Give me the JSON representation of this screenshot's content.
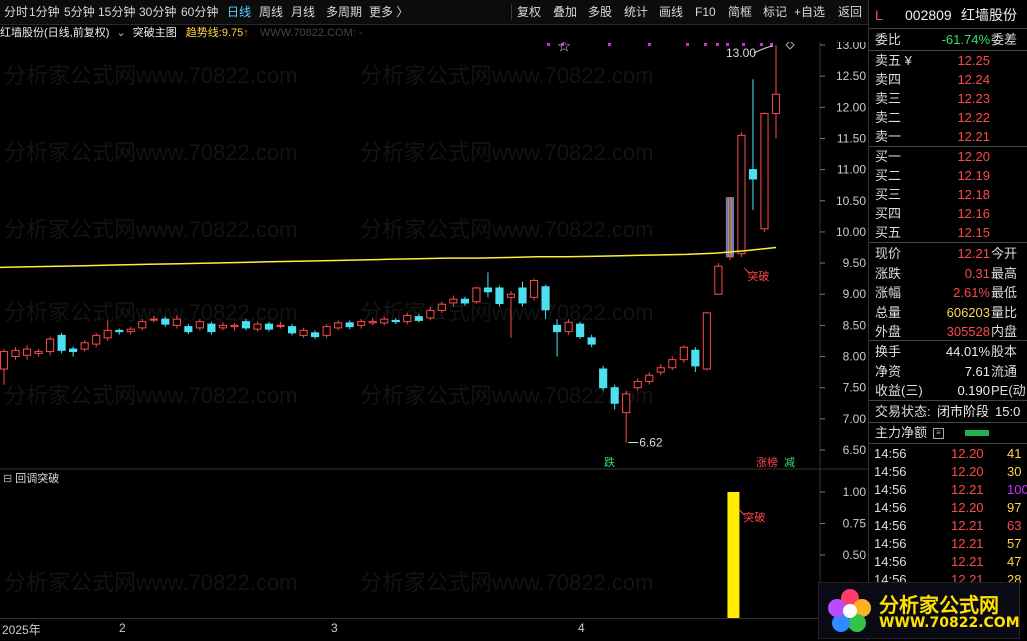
{
  "toolbar": {
    "periods": [
      "分时",
      "1分钟",
      "5分钟",
      "15分钟",
      "30分钟",
      "60分钟",
      "日线",
      "周线",
      "月线",
      "多周期",
      "更多 〉"
    ],
    "active_period": "日线",
    "tools": [
      "复权",
      "叠加",
      "多股",
      "统计",
      "画线",
      "F10",
      "简框",
      "标记",
      "+自选",
      "返回"
    ]
  },
  "chart_header": {
    "stock_name": "红墙股份",
    "mode": "(日线,前复权)",
    "indicator": "突破主图",
    "trend_label": "趋势线:",
    "trend_value": "9.75",
    "watermark_url": "WWW.70822.COM: -"
  },
  "watermark_text": "分析家公式网www.70822.com",
  "sub_chart": {
    "title": "回调突破"
  },
  "colors": {
    "up": "#ff4a4a",
    "down": "#4de1f0",
    "trend": "#ffee33",
    "signal": "#ffee00",
    "marker": "#cc33cc"
  },
  "annotations": {
    "high_label": "13.00",
    "low_label": "6.62",
    "breakout_label": "突破",
    "sub_breakout_label": "突破",
    "fall_tag": "跌",
    "limit_tag_1": "涨榜",
    "limit_tag_2": "减"
  },
  "date_axis": [
    "2025年",
    "2",
    "3",
    "4"
  ],
  "chart_data": {
    "type": "candlestick",
    "price_axis": {
      "ticks": [
        "13.00",
        "12.50",
        "12.00",
        "11.50",
        "11.00",
        "10.50",
        "10.00",
        "9.50",
        "9.00",
        "8.50",
        "8.00",
        "7.50",
        "7.00",
        "6.50"
      ],
      "range": [
        6.35,
        13.3
      ]
    },
    "candles": [
      [
        7.8,
        8.08,
        7.55,
        8.12
      ],
      [
        8.0,
        8.1,
        7.95,
        8.15
      ],
      [
        8.02,
        8.12,
        7.95,
        8.18
      ],
      [
        8.05,
        8.08,
        8.0,
        8.12
      ],
      [
        8.08,
        8.28,
        8.02,
        8.32
      ],
      [
        8.34,
        8.1,
        8.05,
        8.38
      ],
      [
        8.12,
        8.08,
        8.0,
        8.16
      ],
      [
        8.12,
        8.22,
        8.08,
        8.26
      ],
      [
        8.2,
        8.34,
        8.15,
        8.38
      ],
      [
        8.3,
        8.42,
        8.25,
        8.58
      ],
      [
        8.42,
        8.4,
        8.35,
        8.45
      ],
      [
        8.4,
        8.44,
        8.35,
        8.48
      ],
      [
        8.46,
        8.56,
        8.42,
        8.6
      ],
      [
        8.6,
        8.6,
        8.55,
        8.65
      ],
      [
        8.6,
        8.52,
        8.48,
        8.64
      ],
      [
        8.5,
        8.6,
        8.45,
        8.66
      ],
      [
        8.48,
        8.4,
        8.36,
        8.52
      ],
      [
        8.46,
        8.56,
        8.42,
        8.6
      ],
      [
        8.52,
        8.4,
        8.35,
        8.56
      ],
      [
        8.46,
        8.5,
        8.42,
        8.55
      ],
      [
        8.48,
        8.5,
        8.42,
        8.54
      ],
      [
        8.56,
        8.46,
        8.42,
        8.6
      ],
      [
        8.44,
        8.52,
        8.4,
        8.56
      ],
      [
        8.52,
        8.44,
        8.4,
        8.56
      ],
      [
        8.5,
        8.5,
        8.45,
        8.56
      ],
      [
        8.48,
        8.38,
        8.34,
        8.52
      ],
      [
        8.34,
        8.42,
        8.3,
        8.46
      ],
      [
        8.38,
        8.32,
        8.28,
        8.42
      ],
      [
        8.34,
        8.48,
        8.3,
        8.52
      ],
      [
        8.46,
        8.54,
        8.42,
        8.58
      ],
      [
        8.54,
        8.48,
        8.44,
        8.58
      ],
      [
        8.5,
        8.56,
        8.45,
        8.6
      ],
      [
        8.54,
        8.56,
        8.5,
        8.62
      ],
      [
        8.54,
        8.6,
        8.5,
        8.64
      ],
      [
        8.58,
        8.56,
        8.52,
        8.62
      ],
      [
        8.56,
        8.66,
        8.52,
        8.7
      ],
      [
        8.64,
        8.58,
        8.55,
        8.68
      ],
      [
        8.62,
        8.74,
        8.58,
        8.8
      ],
      [
        8.74,
        8.84,
        8.7,
        8.88
      ],
      [
        8.86,
        8.92,
        8.8,
        8.98
      ],
      [
        8.92,
        8.86,
        8.82,
        8.96
      ],
      [
        8.88,
        9.1,
        8.85,
        9.12
      ],
      [
        9.1,
        9.04,
        8.95,
        9.35
      ],
      [
        9.1,
        8.85,
        8.8,
        9.14
      ],
      [
        8.95,
        9.0,
        8.3,
        9.05
      ],
      [
        9.1,
        8.86,
        8.8,
        9.2
      ],
      [
        8.95,
        9.22,
        8.9,
        9.25
      ],
      [
        9.12,
        8.75,
        8.6,
        9.15
      ],
      [
        8.5,
        8.4,
        8.0,
        8.6
      ],
      [
        8.4,
        8.55,
        8.35,
        8.6
      ],
      [
        8.52,
        8.32,
        8.28,
        8.56
      ],
      [
        8.3,
        8.2,
        8.15,
        8.35
      ],
      [
        7.8,
        7.5,
        7.45,
        7.85
      ],
      [
        7.5,
        7.25,
        7.15,
        7.55
      ],
      [
        7.1,
        7.4,
        6.62,
        7.45
      ],
      [
        7.5,
        7.6,
        7.45,
        7.65
      ],
      [
        7.6,
        7.7,
        7.55,
        7.75
      ],
      [
        7.75,
        7.82,
        7.7,
        7.88
      ],
      [
        7.82,
        7.95,
        7.78,
        8.0
      ],
      [
        7.95,
        8.15,
        7.9,
        8.18
      ],
      [
        8.1,
        7.85,
        7.75,
        8.15
      ],
      [
        7.8,
        8.7,
        7.78,
        8.72
      ],
      [
        9.0,
        9.45,
        9.0,
        9.5
      ],
      [
        9.6,
        10.55,
        9.55,
        10.56
      ],
      [
        9.65,
        11.55,
        9.6,
        11.6
      ],
      [
        11.0,
        10.85,
        10.35,
        12.45
      ],
      [
        10.05,
        11.9,
        10.0,
        11.92
      ],
      [
        11.9,
        12.21,
        11.5,
        13.0
      ]
    ],
    "trend_line": [
      9.43,
      9.44,
      9.45,
      9.46,
      9.47,
      9.48,
      9.49,
      9.5,
      9.51,
      9.52,
      9.53,
      9.54,
      9.55,
      9.56,
      9.57,
      9.58,
      9.58,
      9.59,
      9.6,
      9.6,
      9.61,
      9.62,
      9.63,
      9.64,
      9.66,
      9.7,
      9.75
    ],
    "sub_series": {
      "name": "回调突破",
      "ticks": [
        "1.00",
        "0.75",
        "0.50"
      ],
      "range": [
        0,
        1.0
      ],
      "signal_value": 1.0
    }
  },
  "panel": {
    "stock_code": "002809",
    "stock_name": "红墙股份",
    "market_tag": "L",
    "weibi_label": "委比",
    "weibi_value": "-61.74%",
    "weicha_label": "委差",
    "sell": [
      {
        "label": "卖五 ¥",
        "price": "12.25"
      },
      {
        "label": "卖四",
        "price": "12.24"
      },
      {
        "label": "卖三",
        "price": "12.23"
      },
      {
        "label": "卖二",
        "price": "12.22"
      },
      {
        "label": "卖一",
        "price": "12.21"
      }
    ],
    "buy": [
      {
        "label": "买一",
        "price": "12.20"
      },
      {
        "label": "买二",
        "price": "12.19"
      },
      {
        "label": "买三",
        "price": "12.18"
      },
      {
        "label": "买四",
        "price": "12.16"
      },
      {
        "label": "买五",
        "price": "12.15"
      }
    ],
    "stats": [
      {
        "label": "现价",
        "value": "12.21",
        "label2": "今开",
        "color": "red"
      },
      {
        "label": "涨跌",
        "value": "0.31",
        "label2": "最高",
        "color": "red"
      },
      {
        "label": "涨幅",
        "value": "2.61%",
        "label2": "最低",
        "color": "red"
      },
      {
        "label": "总量",
        "value": "606203",
        "label2": "量比",
        "color": "yellow"
      },
      {
        "label": "外盘",
        "value": "305528",
        "label2": "内盘",
        "color": "red"
      }
    ],
    "stats2": [
      {
        "label": "换手",
        "value": "44.01%",
        "label2": "股本"
      },
      {
        "label": "净资",
        "value": "7.61",
        "label2": "流通"
      },
      {
        "label": "收益(三)",
        "value": "0.190",
        "label2": "PE(动"
      }
    ],
    "trade_status_label": "交易状态:",
    "trade_status_value": "闭市阶段",
    "trade_time": "15:0",
    "capital_label": "主力净额",
    "ticks": [
      {
        "time": "14:56",
        "price": "12.20",
        "qty": "41"
      },
      {
        "time": "14:56",
        "price": "12.20",
        "qty": "30"
      },
      {
        "time": "14:56",
        "price": "12.21",
        "qty": "100"
      },
      {
        "time": "14:56",
        "price": "12.20",
        "qty": "97"
      },
      {
        "time": "14:56",
        "price": "12.21",
        "qty": "63"
      },
      {
        "time": "14:56",
        "price": "12.21",
        "qty": "57"
      },
      {
        "time": "14:56",
        "price": "12.21",
        "qty": "47"
      },
      {
        "time": "14:56",
        "price": "12.21",
        "qty": "28"
      }
    ]
  },
  "logo": {
    "title": "分析家公式网",
    "url": "WWW.70822.COM"
  }
}
